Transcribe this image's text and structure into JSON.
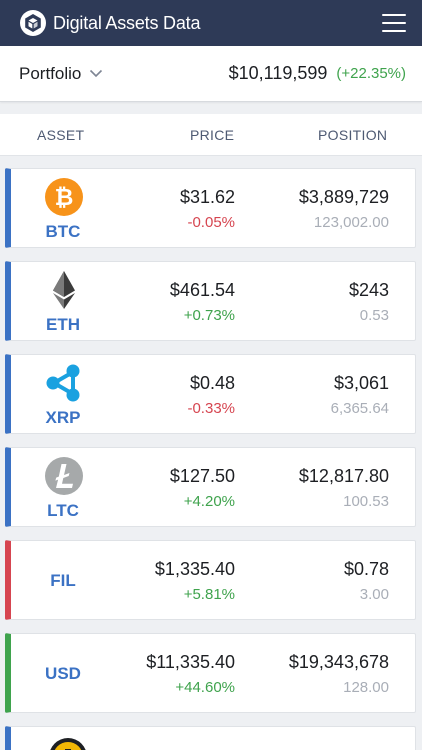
{
  "header": {
    "app_title": "Digital Assets Data",
    "logo_icon": "cube-logo-icon",
    "menu_icon": "hamburger-menu-icon"
  },
  "portfolio": {
    "label": "Portfolio",
    "total": "$10,119,599",
    "change": "(+22.35%)"
  },
  "columns": {
    "asset": "ASSET",
    "price": "PRICE",
    "position": "POSITION"
  },
  "colors": {
    "brand": "#2e3a57",
    "blue": "#3b72c4",
    "red": "#d64550",
    "green": "#3fa34d"
  },
  "assets": [
    {
      "ticker": "BTC",
      "price": "$31.62",
      "change": "-0.05%",
      "position": "$3,889,729",
      "quantity": "123,002.00",
      "icon": "bitcoin-icon"
    },
    {
      "ticker": "ETH",
      "price": "$461.54",
      "change": "+0.73%",
      "position": "$243",
      "quantity": "0.53",
      "icon": "ethereum-icon"
    },
    {
      "ticker": "XRP",
      "price": "$0.48",
      "change": "-0.33%",
      "position": "$3,061",
      "quantity": "6,365.64",
      "icon": "ripple-icon"
    },
    {
      "ticker": "LTC",
      "price": "$127.50",
      "change": "+4.20%",
      "position": "$12,817.80",
      "quantity": "100.53",
      "icon": "litecoin-icon"
    },
    {
      "ticker": "FIL",
      "price": "$1,335.40",
      "change": "+5.81%",
      "position": "$0.78",
      "quantity": "3.00",
      "icon": ""
    },
    {
      "ticker": "USD",
      "price": "$11,335.40",
      "change": "+44.60%",
      "position": "$19,343,678",
      "quantity": "128.00",
      "icon": ""
    }
  ]
}
